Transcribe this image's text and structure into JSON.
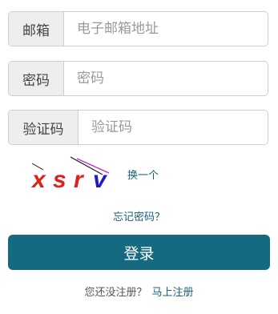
{
  "form": {
    "email": {
      "label": "邮箱",
      "placeholder": "电子邮箱地址",
      "value": ""
    },
    "password": {
      "label": "密码",
      "placeholder": "密码",
      "value": ""
    },
    "captcha": {
      "label": "验证码",
      "placeholder": "验证码",
      "value": ""
    }
  },
  "captcha_image": {
    "chars": [
      {
        "text": "x",
        "color": "#e0201a"
      },
      {
        "text": "s",
        "color": "#e0201a"
      },
      {
        "text": "r",
        "color": "#e0201a"
      },
      {
        "text": "v",
        "color": "#1a1acc"
      }
    ],
    "refresh_label": "换一个"
  },
  "forgot_password": "忘记密码？",
  "login_button": "登录",
  "register": {
    "prompt": "您还没注册？",
    "link": "马上注册"
  },
  "colors": {
    "primary": "#156a80",
    "link": "#1a5f7a",
    "border": "#cfcfcf",
    "addon_bg": "#eeeeee"
  }
}
